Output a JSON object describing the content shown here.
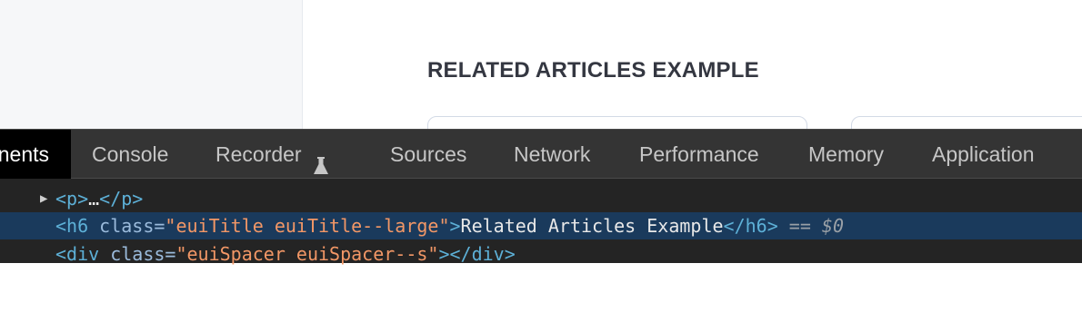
{
  "page": {
    "section_title": "RELATED ARTICLES EXAMPLE"
  },
  "devtools": {
    "tabs": {
      "elements": "nents",
      "console": "Console",
      "recorder": "Recorder",
      "sources": "Sources",
      "network": "Network",
      "performance": "Performance",
      "memory": "Memory",
      "application": "Application"
    },
    "active_tab": "Elements",
    "dom": {
      "line1": {
        "open": "<p>",
        "ellipsis": "…",
        "close": "</p>"
      },
      "line2": {
        "open_tag": "<h6",
        "attr_name": " class=",
        "attr_value": "\"euiTitle euiTitle--large\"",
        "gt": ">",
        "text": "Related Articles Example",
        "close_tag": "</h6>",
        "eq": " == ",
        "ref": "$0"
      },
      "line3": {
        "open_tag": "<div",
        "attr_name": " class=",
        "attr_value": "\"euiSpacer euiSpacer--s\"",
        "gt": ">",
        "close_tag": "</div>"
      }
    }
  },
  "icons": {
    "recorder_tab": "flask-icon",
    "expand": "triangle-right-icon"
  },
  "colors": {
    "devtools_bg": "#242424",
    "tabbar_bg": "#343434",
    "selected_row": "#1a3a5c",
    "tag": "#5db0d7",
    "attr_value": "#f29766"
  }
}
